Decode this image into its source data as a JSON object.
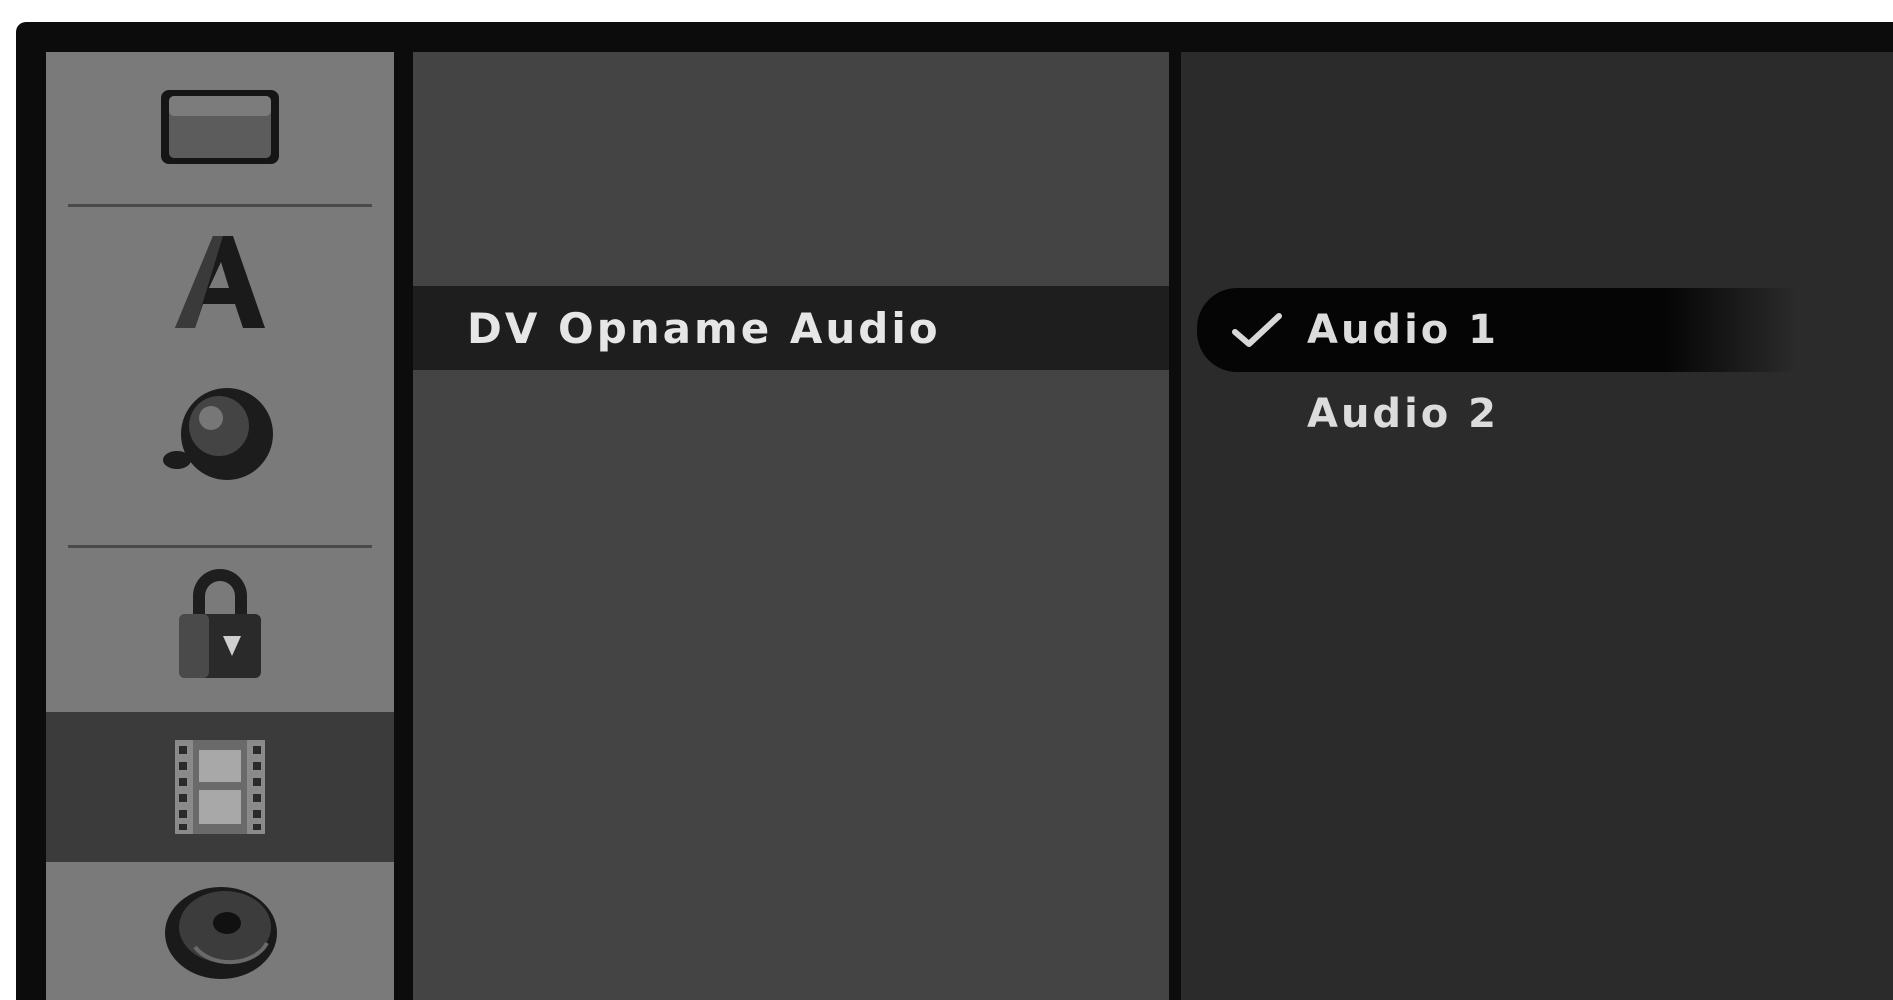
{
  "sidebar": {
    "items": [
      {
        "icon": "tv-screen-icon",
        "selected": false
      },
      {
        "icon": "letter-a-icon",
        "selected": false
      },
      {
        "icon": "speaker-sphere-icon",
        "selected": false
      },
      {
        "icon": "padlock-icon",
        "selected": false
      },
      {
        "icon": "film-strip-icon",
        "selected": true
      },
      {
        "icon": "disc-icon",
        "selected": false
      }
    ]
  },
  "menu": {
    "items": [
      {
        "label": "",
        "state": "dimmed"
      },
      {
        "label": "",
        "state": "dimmed"
      },
      {
        "label": "DV Opname Audio",
        "state": "highlighted"
      },
      {
        "label": "",
        "state": "dimmed"
      }
    ]
  },
  "options": {
    "items": [
      {
        "label": "Audio 1",
        "checked": true,
        "highlighted": true
      },
      {
        "label": "Audio 2",
        "checked": false,
        "highlighted": false
      }
    ]
  },
  "colors": {
    "sidebar_bg": "#7a7a7a",
    "sidebar_selected": "#3b3b3b",
    "menu_bg": "#444444",
    "menu_highlight": "#1e1e1e",
    "options_bg": "#2b2b2b",
    "text": "#e6e6e6"
  }
}
